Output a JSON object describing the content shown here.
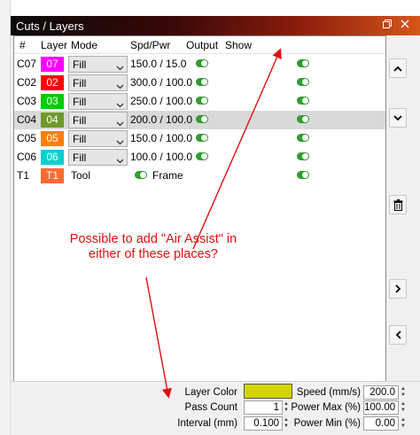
{
  "window": {
    "title": "Cuts / Layers"
  },
  "columns": [
    "#",
    "Layer",
    "Mode",
    "Spd/Pwr",
    "Output",
    "Show"
  ],
  "rows": [
    {
      "id": "C07",
      "layer": "07",
      "color": "#ff00ff",
      "text_color": "#ffffff",
      "mode": "Fill",
      "spd_pwr": "150.0 / 15.0",
      "output": true,
      "show": true,
      "selected": false
    },
    {
      "id": "C02",
      "layer": "02",
      "color": "#ff0000",
      "text_color": "#ffffff",
      "mode": "Fill",
      "spd_pwr": "300.0 / 100.0",
      "output": true,
      "show": true,
      "selected": false
    },
    {
      "id": "C03",
      "layer": "03",
      "color": "#00cc00",
      "text_color": "#ffffff",
      "mode": "Fill",
      "spd_pwr": "250.0 / 100.0",
      "output": true,
      "show": true,
      "selected": false
    },
    {
      "id": "C04",
      "layer": "04",
      "color": "#6e9a2a",
      "text_color": "#ffffff",
      "mode": "Fill",
      "spd_pwr": "200.0 / 100.0",
      "output": true,
      "show": true,
      "selected": true
    },
    {
      "id": "C05",
      "layer": "05",
      "color": "#ff8000",
      "text_color": "#ffffff",
      "mode": "Fill",
      "spd_pwr": "150.0 / 100.0",
      "output": true,
      "show": true,
      "selected": false
    },
    {
      "id": "C06",
      "layer": "06",
      "color": "#00d0d0",
      "text_color": "#ffffff",
      "mode": "Fill",
      "spd_pwr": "100.0 / 100.0",
      "output": true,
      "show": true,
      "selected": false
    }
  ],
  "tool_row": {
    "id": "T1",
    "layer": "T1",
    "color": "#ff6a33",
    "mode_text": "Tool",
    "output": true,
    "frame_label": "Frame",
    "show": true
  },
  "annotation": "Possible to add \"Air Assist\" in either of these places?",
  "bottom": {
    "layer_color_label": "Layer Color",
    "layer_color": "#d4d400",
    "pass_count_label": "Pass Count",
    "pass_count": "1",
    "interval_label": "Interval (mm)",
    "interval": "0.100",
    "speed_label": "Speed (mm/s)",
    "speed": "200.0",
    "power_max_label": "Power Max (%)",
    "power_max": "100.00",
    "power_min_label": "Power Min (%)",
    "power_min": "0.00"
  },
  "icons": [
    "restore-icon",
    "close-icon",
    "arrow-up-icon",
    "arrow-down-icon",
    "trash-icon",
    "arrow-right-icon",
    "arrow-left-icon"
  ]
}
